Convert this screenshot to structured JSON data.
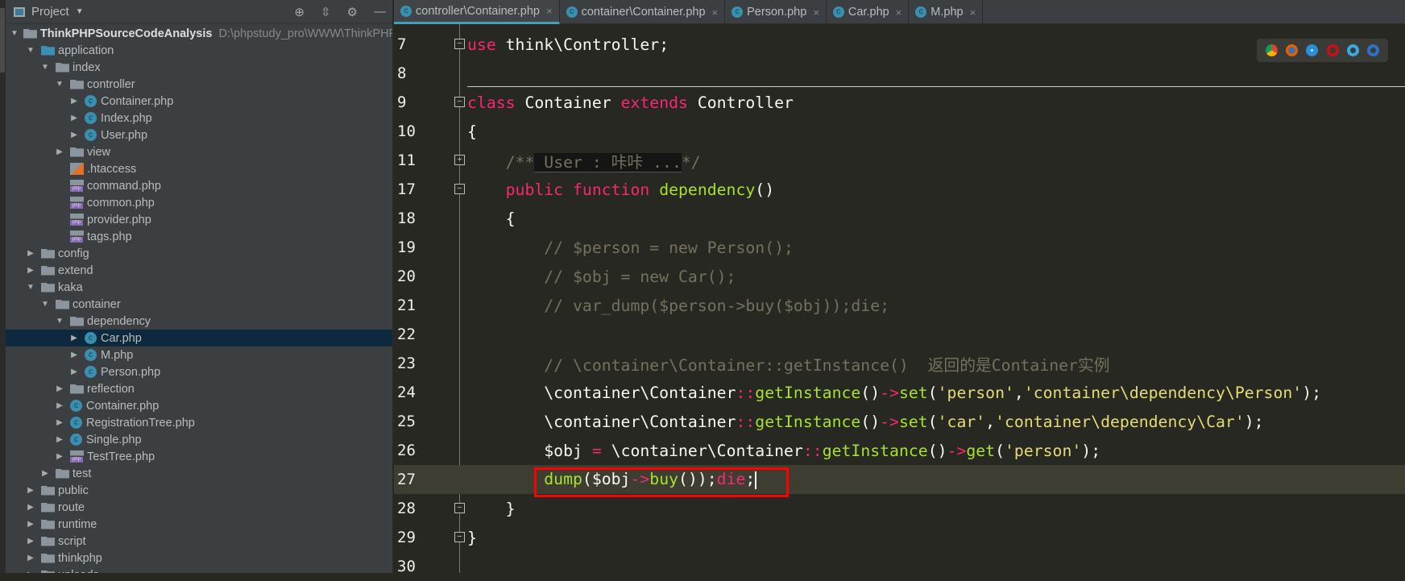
{
  "sidebar": {
    "title": "Project",
    "root_path": "D:\\phpstudy_pro\\WWW\\ThinkPHPSourceCo",
    "items": [
      {
        "label": "ThinkPHPSourceCodeAnalysis",
        "indent": 0,
        "arrow": "down",
        "icon": "folder",
        "root": true
      },
      {
        "label": "application",
        "indent": 1,
        "arrow": "down",
        "icon": "folder-blue"
      },
      {
        "label": "index",
        "indent": 2,
        "arrow": "down",
        "icon": "folder"
      },
      {
        "label": "controller",
        "indent": 3,
        "arrow": "down",
        "icon": "folder"
      },
      {
        "label": "Container.php",
        "indent": 4,
        "arrow": "right",
        "icon": "class"
      },
      {
        "label": "Index.php",
        "indent": 4,
        "arrow": "right",
        "icon": "class"
      },
      {
        "label": "User.php",
        "indent": 4,
        "arrow": "right",
        "icon": "class"
      },
      {
        "label": "view",
        "indent": 3,
        "arrow": "right",
        "icon": "folder"
      },
      {
        "label": ".htaccess",
        "indent": 3,
        "arrow": "none",
        "icon": "htaccess"
      },
      {
        "label": "command.php",
        "indent": 3,
        "arrow": "none",
        "icon": "php"
      },
      {
        "label": "common.php",
        "indent": 3,
        "arrow": "none",
        "icon": "php"
      },
      {
        "label": "provider.php",
        "indent": 3,
        "arrow": "none",
        "icon": "php"
      },
      {
        "label": "tags.php",
        "indent": 3,
        "arrow": "none",
        "icon": "php"
      },
      {
        "label": "config",
        "indent": 1,
        "arrow": "right",
        "icon": "folder"
      },
      {
        "label": "extend",
        "indent": 1,
        "arrow": "right",
        "icon": "folder"
      },
      {
        "label": "kaka",
        "indent": 1,
        "arrow": "down",
        "icon": "folder"
      },
      {
        "label": "container",
        "indent": 2,
        "arrow": "down",
        "icon": "folder"
      },
      {
        "label": "dependency",
        "indent": 3,
        "arrow": "down",
        "icon": "folder"
      },
      {
        "label": "Car.php",
        "indent": 4,
        "arrow": "right",
        "icon": "class",
        "selected": true
      },
      {
        "label": "M.php",
        "indent": 4,
        "arrow": "right",
        "icon": "class"
      },
      {
        "label": "Person.php",
        "indent": 4,
        "arrow": "right",
        "icon": "class"
      },
      {
        "label": "reflection",
        "indent": 3,
        "arrow": "right",
        "icon": "folder"
      },
      {
        "label": "Container.php",
        "indent": 3,
        "arrow": "right",
        "icon": "class"
      },
      {
        "label": "RegistrationTree.php",
        "indent": 3,
        "arrow": "right",
        "icon": "class"
      },
      {
        "label": "Single.php",
        "indent": 3,
        "arrow": "right",
        "icon": "class"
      },
      {
        "label": "TestTree.php",
        "indent": 3,
        "arrow": "right",
        "icon": "php"
      },
      {
        "label": "test",
        "indent": 2,
        "arrow": "right",
        "icon": "folder"
      },
      {
        "label": "public",
        "indent": 1,
        "arrow": "right",
        "icon": "folder"
      },
      {
        "label": "route",
        "indent": 1,
        "arrow": "right",
        "icon": "folder"
      },
      {
        "label": "runtime",
        "indent": 1,
        "arrow": "right",
        "icon": "folder"
      },
      {
        "label": "script",
        "indent": 1,
        "arrow": "right",
        "icon": "folder"
      },
      {
        "label": "thinkphp",
        "indent": 1,
        "arrow": "right",
        "icon": "folder"
      },
      {
        "label": "uploads",
        "indent": 1,
        "arrow": "right",
        "icon": "folder"
      }
    ]
  },
  "tabs": [
    {
      "label": "controller\\Container.php",
      "active": true
    },
    {
      "label": "container\\Container.php"
    },
    {
      "label": "Person.php"
    },
    {
      "label": "Car.php"
    },
    {
      "label": "M.php"
    }
  ],
  "code": [
    {
      "num": "7",
      "fold": "-",
      "t": [
        [
          "use",
          "k"
        ],
        [
          " think\\Controller;",
          "p"
        ]
      ]
    },
    {
      "num": "8",
      "t": []
    },
    {
      "num": "9",
      "fold": "-",
      "t": [
        [
          "class",
          "k"
        ],
        [
          " Container ",
          "p"
        ],
        [
          "extends",
          "k"
        ],
        [
          " Controller",
          "p"
        ]
      ]
    },
    {
      "num": "10",
      "t": [
        [
          "{",
          "p"
        ]
      ]
    },
    {
      "num": "11",
      "fold": "+",
      "t": [
        [
          "    /**",
          "c"
        ],
        [
          " User : 咔咔 ...",
          "fd"
        ],
        [
          "*/",
          "c"
        ]
      ]
    },
    {
      "num": "17",
      "fold": "-",
      "t": [
        [
          "    public function ",
          "k"
        ],
        [
          "dependency",
          "f"
        ],
        [
          "()",
          "p"
        ]
      ]
    },
    {
      "num": "18",
      "t": [
        [
          "    {",
          "p"
        ]
      ]
    },
    {
      "num": "19",
      "t": [
        [
          "        // $person = new Person();",
          "c"
        ]
      ]
    },
    {
      "num": "20",
      "t": [
        [
          "        // $obj = new Car();",
          "c"
        ]
      ]
    },
    {
      "num": "21",
      "t": [
        [
          "        // var_dump($person->buy($obj));die;",
          "c"
        ]
      ]
    },
    {
      "num": "22",
      "t": []
    },
    {
      "num": "23",
      "t": [
        [
          "        // \\container\\Container::getInstance()  返回的是Container实例",
          "c"
        ]
      ]
    },
    {
      "num": "24",
      "t": [
        [
          "        \\container\\Container",
          "p"
        ],
        [
          "::",
          "k"
        ],
        [
          "getInstance",
          "f"
        ],
        [
          "()",
          "p"
        ],
        [
          "->",
          "k"
        ],
        [
          "set",
          "f"
        ],
        [
          "(",
          "p"
        ],
        [
          "'person'",
          "s"
        ],
        [
          ",",
          "p"
        ],
        [
          "'container\\dependency\\Person'",
          "s"
        ],
        [
          ");",
          "p"
        ]
      ]
    },
    {
      "num": "25",
      "t": [
        [
          "        \\container\\Container",
          "p"
        ],
        [
          "::",
          "k"
        ],
        [
          "getInstance",
          "f"
        ],
        [
          "()",
          "p"
        ],
        [
          "->",
          "k"
        ],
        [
          "set",
          "f"
        ],
        [
          "(",
          "p"
        ],
        [
          "'car'",
          "s"
        ],
        [
          ",",
          "p"
        ],
        [
          "'container\\dependency\\Car'",
          "s"
        ],
        [
          ");",
          "p"
        ]
      ]
    },
    {
      "num": "26",
      "t": [
        [
          "        $obj ",
          "p"
        ],
        [
          "=",
          "k"
        ],
        [
          " \\container\\Container",
          "p"
        ],
        [
          "::",
          "k"
        ],
        [
          "getInstance",
          "f"
        ],
        [
          "()",
          "p"
        ],
        [
          "->",
          "k"
        ],
        [
          "get",
          "f"
        ],
        [
          "(",
          "p"
        ],
        [
          "'person'",
          "s"
        ],
        [
          ");",
          "p"
        ]
      ]
    },
    {
      "num": "27",
      "current": true,
      "t": [
        [
          "        dump",
          "f"
        ],
        [
          "($obj",
          "p"
        ],
        [
          "->",
          "k"
        ],
        [
          "buy",
          "f"
        ],
        [
          "());",
          "p"
        ],
        [
          "die",
          "k"
        ],
        [
          ";",
          "p"
        ]
      ]
    },
    {
      "num": "28",
      "fold": "-",
      "t": [
        [
          "    }",
          "p"
        ]
      ]
    },
    {
      "num": "29",
      "fold": "-",
      "t": [
        [
          "}",
          "p"
        ]
      ]
    },
    {
      "num": "30",
      "t": []
    }
  ],
  "browsers": [
    "chrome-icon",
    "firefox-icon",
    "safari-icon",
    "opera-icon",
    "ie-icon",
    "edge-icon"
  ],
  "colors": {
    "keyword": "#f92672",
    "function": "#a6e22e",
    "string": "#e6db74",
    "comment": "#75715e",
    "highlight_box": "#ff0000"
  }
}
